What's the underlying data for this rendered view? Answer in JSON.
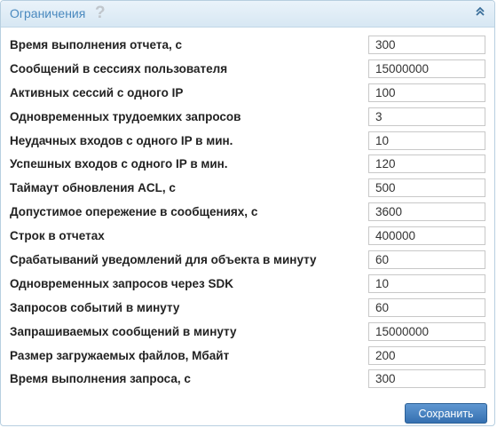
{
  "panel": {
    "title": "Ограничения",
    "help_glyph": "?",
    "collapse_glyph": "«"
  },
  "fields": [
    {
      "label": "Время выполнения отчета, с",
      "value": "300"
    },
    {
      "label": "Сообщений в сессиях пользователя",
      "value": "15000000"
    },
    {
      "label": "Активных сессий с одного IP",
      "value": "100"
    },
    {
      "label": "Одновременных трудоемких запросов",
      "value": "3"
    },
    {
      "label": "Неудачных входов с одного IP в мин.",
      "value": "10"
    },
    {
      "label": "Успешных входов с одного IP в мин.",
      "value": "120"
    },
    {
      "label": "Таймаут обновления ACL, с",
      "value": "500"
    },
    {
      "label": "Допустимое опережение в сообщениях, с",
      "value": "3600"
    },
    {
      "label": "Строк в отчетах",
      "value": "400000"
    },
    {
      "label": "Срабатываний уведомлений для объекта в минуту",
      "value": "60"
    },
    {
      "label": "Одновременных запросов через SDK",
      "value": "10"
    },
    {
      "label": "Запросов событий в минуту",
      "value": "60"
    },
    {
      "label": "Запрашиваемых сообщений в минуту",
      "value": "15000000"
    },
    {
      "label": "Размер загружаемых файлов, Мбайт",
      "value": "200"
    },
    {
      "label": "Время выполнения запроса, с",
      "value": "300"
    }
  ],
  "save_label": "Сохранить"
}
